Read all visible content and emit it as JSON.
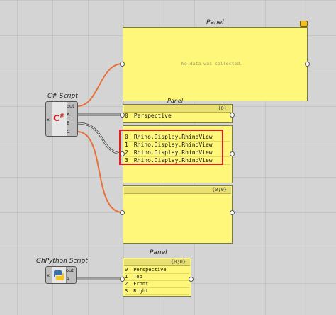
{
  "cs_component": {
    "title": "C# Script",
    "input_x": "x",
    "outputs": [
      "out",
      "A",
      "B",
      "C"
    ]
  },
  "py_component": {
    "title": "GhPython Script",
    "input_x": "x",
    "outputs": [
      "out",
      "a"
    ]
  },
  "panels": [
    {
      "title": "Panel",
      "empty_message": "No data was collected.",
      "rows": []
    },
    {
      "title": "Panel",
      "path": "{0}",
      "rows": [
        {
          "idx": "0",
          "text": "Perspective"
        }
      ]
    },
    {
      "path": "",
      "rows": [
        {
          "idx": "0",
          "text": "Rhino.Display.RhinoView"
        },
        {
          "idx": "1",
          "text": "Rhino.Display.RhinoView"
        },
        {
          "idx": "2",
          "text": "Rhino.Display.RhinoView"
        },
        {
          "idx": "3",
          "text": "Rhino.Display.RhinoView"
        }
      ]
    },
    {
      "path": "{0;0}",
      "rows": []
    },
    {
      "title": "Panel",
      "path": "{0;0}",
      "rows": [
        {
          "idx": "0",
          "text": "Perspective"
        },
        {
          "idx": "1",
          "text": "Top"
        },
        {
          "idx": "2",
          "text": "Front"
        },
        {
          "idx": "3",
          "text": "Right"
        }
      ]
    }
  ],
  "colors": {
    "panel_fill": "#fff77a",
    "wire_orange": "#e8703a",
    "wire_gray": "#555555",
    "highlight": "#e11d1d"
  }
}
